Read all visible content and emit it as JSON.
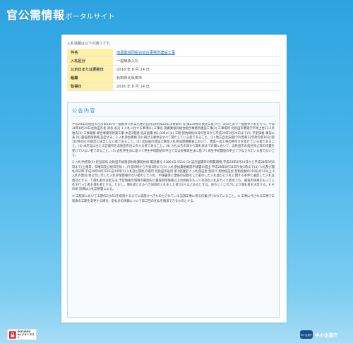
{
  "header": {
    "logo_main": "官公需情報",
    "logo_sub": "ポータルサイト"
  },
  "intro_text": "入札情報は以下の通りです。",
  "info_rows": [
    {
      "label": "件名",
      "value": "南農業協同組合総合事務所建設工事",
      "is_link": true
    },
    {
      "label": "入札区分",
      "value": "一般競争入札",
      "is_link": false
    },
    {
      "label": "公示日または更新日",
      "value": "2016 年 8 月 24 日",
      "is_link": false
    },
    {
      "label": "組織",
      "value": "秋田県北秋田市",
      "is_link": false
    },
    {
      "label": "取得日",
      "value": "2016 年 8 月 24 日",
      "is_link": false
    }
  ],
  "notice": {
    "title": "公告内容",
    "paragraphs": [
      "平成28年北秋田市告示第185号一般競争入札公告地方自治法(昭和22年法律第67号)第234条の規定に基づき、次のとおり一般競争入札を行う。平成28年8月24日北秋田市長 津谷 永光 1 入札に付する事項(1) 工事名 南農業協同組合総合事務所建設工事(2) 工事場所 北秋田市鷹巣字平崎上台13-1外 地内(3) 工事概要 総合事務所新築工事 木造2階建 延床面積 約1,000㎡ (4) 工期 契約締結の日の翌日から平成29年3月24日まで(5) 予定価格 事前公表 (6) 最低制限価格 設定する。2 入札参加資格 次に掲げる要件をすべて満たしている者であること。(1) 地方自治法施行令(昭和22年政令第16号)第167条の4 の規定に該当しない者であること。(2) 北秋田市建設工事等入札参加資格審査において、建築一式工事の格付けを受けている者であること。(3) 本店又は主たる営業所を北秋田市内に有する者であること。(4) 入札公告の日から開札日までの間において、北秋田市の指名停止等の措置を受けていない者であること。(5) 会社更生法に基づく更生手続開始の申立て又は民事再生法に基づく再生手続開始の申立てがなされている者でないこと。",
      "3 入札手続等(1) 担当部局 北秋田市総務部財政課契約係 電話番号 0186-62-5516 (2) 設計図書等の閲覧期間 平成28年8月24日から平成28年9月6日まで(土曜日、日曜日及び祝日を除く。)午前9時から午後5時まで(3) 入札参加資格確認申請書の提出 平成28年8月31日午後5時まで(4) 入札及び開札の日時 平成28年9月7日午前10時(5) 入札及び開札の場所 北秋田市役所 第1会議室 4 入札保証金 免除 5 契約保証金 契約金額の100分の10以上 6 入札の無効 本公告に示した入札参加資格のない者のした入札、申請書等に虚偽の記載をした者のした入札並びに入札に関する条件に違反した入札は無効とする。7 落札者の決定方法 予定価格の制限の範囲内で最低制限価格以上の価格をもって有効な入札を行った者のうち、最低の価格をもって入札を行った者を落札者とする。ただし、落札者となるべき同価の入札をした者が2人以上あるときは、直ちにくじ引きにより落札者を決定する。8 その他 詳細は入札説明書による。"
    ],
    "footnote": "② 工程表において工期の2分の1を経過するまでに実施すべきものとされている当該工事に係る作業が行われていること。② 工事に付される工事で工程表の工期を変更する場合、前払金の残額について第二回の支払を請求できるものとする。"
  },
  "footer": {
    "secured_line1": "SECURED",
    "secured_line2": "by ジオトラスト",
    "agency_emblem": "中小企業庁",
    "agency_name": "中小企業庁"
  }
}
